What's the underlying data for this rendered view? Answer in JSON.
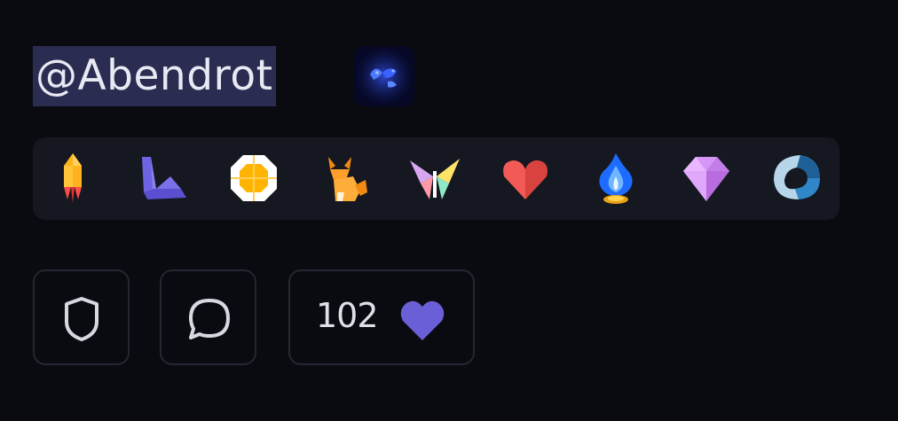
{
  "profile": {
    "username": "@Abendrot",
    "status_emoji": "blue-butterfly-icon"
  },
  "badges": [
    {
      "name": "rocket-badge-icon"
    },
    {
      "name": "purple-chevron-badge-icon"
    },
    {
      "name": "yellow-octagon-badge-icon"
    },
    {
      "name": "fox-badge-icon"
    },
    {
      "name": "butterfly-badge-icon"
    },
    {
      "name": "red-heart-badge-icon"
    },
    {
      "name": "blue-fire-badge-icon"
    },
    {
      "name": "purple-gem-badge-icon"
    },
    {
      "name": "blue-ring-badge-icon"
    }
  ],
  "actions": {
    "report_icon": "shield-icon",
    "message_icon": "chat-bubble-icon",
    "like_count": "102",
    "like_icon": "heart-icon"
  },
  "colors": {
    "background": "#0a0b10",
    "badge_panel": "#151820",
    "username_highlight": "#2b2c52",
    "like_heart": "#6a5fd6"
  }
}
